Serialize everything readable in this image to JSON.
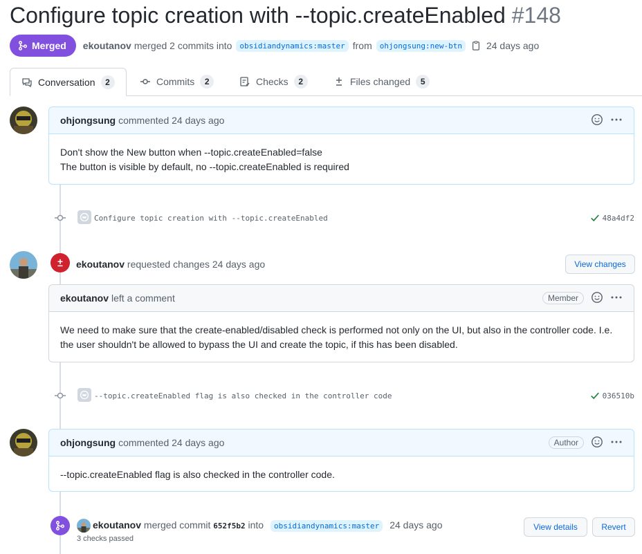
{
  "title": {
    "text": "Configure topic creation with --topic.createEnabled",
    "number": "#148"
  },
  "status": {
    "badge": "Merged",
    "user": "ekoutanov",
    "action": "merged 2 commits into",
    "base_branch": "obsidiandynamics:master",
    "from_word": "from",
    "head_branch": "ohjongsung:new-btn",
    "time": "24 days ago"
  },
  "tabs": [
    {
      "label": "Conversation",
      "count": "2",
      "icon": "conversation-icon"
    },
    {
      "label": "Commits",
      "count": "2",
      "icon": "commit-icon"
    },
    {
      "label": "Checks",
      "count": "2",
      "icon": "checklist-icon"
    },
    {
      "label": "Files changed",
      "count": "5",
      "icon": "diff-icon"
    }
  ],
  "comments": [
    {
      "author": "ohjongsung",
      "action": "commented 24 days ago",
      "label": "",
      "lines": [
        "Don't show the New button when --topic.createEnabled=false",
        "The button is visible by default, no --topic.createEnabled is required"
      ]
    },
    {
      "author": "ekoutanov",
      "action": "left a comment",
      "label": "Member",
      "lines": [
        "We need to make sure that the create-enabled/disabled check is performed not only on the UI, but also in the controller code. I.e.",
        "the user shouldn't be allowed to bypass the UI and create the topic, if this has been disabled."
      ]
    },
    {
      "author": "ohjongsung",
      "action": "commented 24 days ago",
      "label": "Author",
      "lines": [
        "--topic.createEnabled flag is also checked in the controller code."
      ]
    }
  ],
  "commits": [
    {
      "message": "Configure topic creation with --topic.createEnabled",
      "sha": "48a4df2"
    },
    {
      "message": "--topic.createEnabled flag is also checked in the controller code",
      "sha": "036510b"
    }
  ],
  "review": {
    "author": "ekoutanov",
    "action": "requested changes 24 days ago",
    "button": "View changes"
  },
  "merge_event": {
    "author": "ekoutanov",
    "action": "merged commit",
    "commit": "652f5b2",
    "into_word": "into",
    "branch": "obsidiandynamics:master",
    "time": "24 days ago",
    "checks": "3 checks passed",
    "details_button": "View details",
    "revert_button": "Revert"
  },
  "colors": {
    "merged": "#8250df",
    "changes_requested": "#cf222e",
    "success": "#1a7f37",
    "link": "#0969da"
  }
}
